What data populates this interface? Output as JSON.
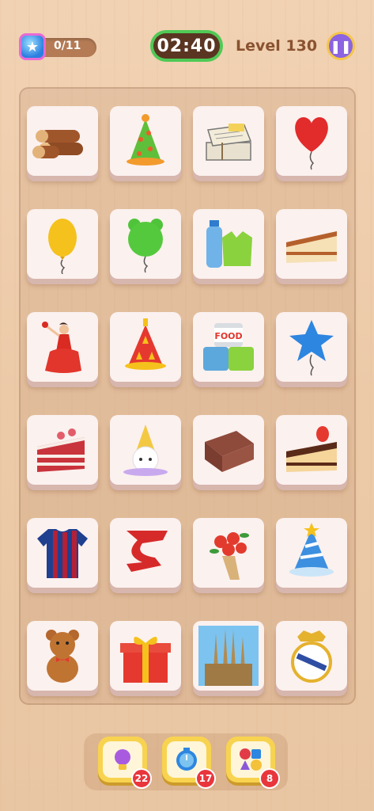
{
  "header": {
    "progress": "0/11",
    "timer": "02:40",
    "level": "Level 130"
  },
  "board": {
    "rows": [
      [
        "logs",
        "party-hat-green",
        "newspaper-stack",
        "heart-balloon"
      ],
      [
        "yellow-balloon",
        "green-bear-balloon",
        "bottle-and-bag",
        "cake-slice"
      ],
      [
        "flamenco-dancer",
        "red-party-hat",
        "food-cans",
        "blue-star-balloon"
      ],
      [
        "red-velvet-cake",
        "unicorn-party-hat",
        "brownie",
        "strawberry-cake"
      ],
      [
        "barcelona-jersey",
        "red-ribbon",
        "flower-bouquet",
        "blue-party-hat"
      ],
      [
        "teddy-bear",
        "gift-box",
        "sagrada-familia",
        "real-madrid-crest"
      ]
    ],
    "food_can_label": "FOOD"
  },
  "boosters": [
    {
      "icon": "lightbulb-icon",
      "count": "22"
    },
    {
      "icon": "timer-freeze-icon",
      "count": "17"
    },
    {
      "icon": "shapes-magnifier-icon",
      "count": "8"
    }
  ],
  "colors": {
    "timer_ring": "#4fc955",
    "pause": "#8c63e0",
    "badge": "#e8363c"
  }
}
